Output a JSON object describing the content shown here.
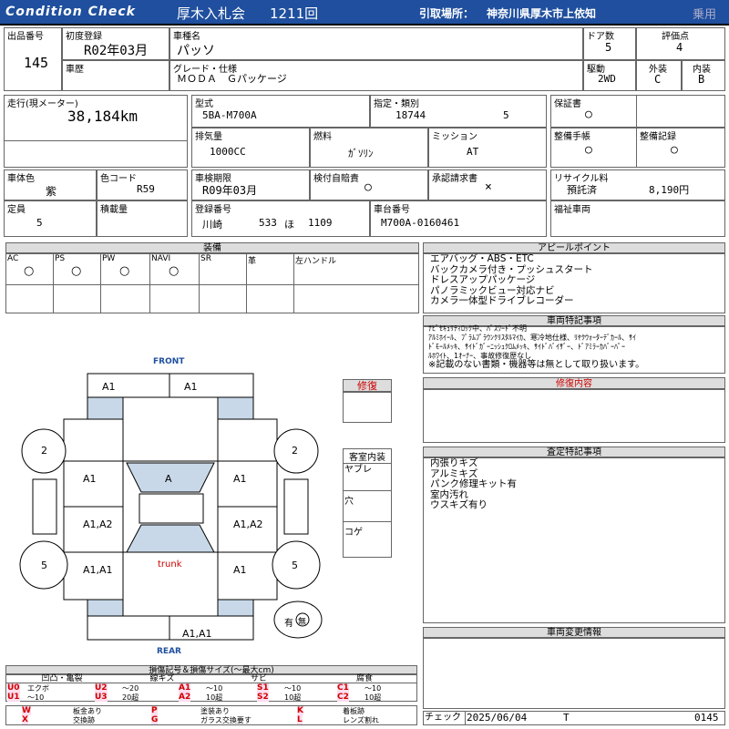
{
  "header": {
    "brand": "Condition Check",
    "auction": "厚木入札会",
    "session": "1211回",
    "pickup_label": "引取場所：",
    "pickup": "神奈川県厚木市上依知",
    "category": "乗用"
  },
  "row1": {
    "lot_label": "出品番号",
    "lot": "145",
    "first_reg_label": "初度登録",
    "first_reg": "R02年03月",
    "model_name_label": "車種名",
    "model_name": "パッソ",
    "doors_label": "ドア数",
    "doors": "5",
    "score_label": "評価点",
    "score": "4",
    "history_label": "車歴",
    "grade_label": "グレード・仕様",
    "grade": "ＭＯＤＡ　Ｇパッケージ",
    "drive_label": "駆動",
    "drive": "2WD",
    "ext_label": "外装",
    "ext": "C",
    "int_label": "内装",
    "int": "B"
  },
  "row2": {
    "mileage_label": "走行(現メーター)",
    "mileage": "38,184km",
    "type_label": "型式",
    "type": "5BA-M700A",
    "designation_label": "指定・類別",
    "designation": "18744",
    "class": "5",
    "warranty_label": "保証書",
    "warranty": "○",
    "displacement_label": "排気量",
    "displacement": "1000CC",
    "fuel_label": "燃料",
    "fuel": "ｶﾞｿﾘﾝ",
    "mission_label": "ミッション",
    "mission": "AT",
    "maint_book_label": "整備手帳",
    "maint_book": "○",
    "maint_record_label": "整備記録",
    "maint_record": "○"
  },
  "row3": {
    "color_label": "車体色",
    "color": "紫",
    "color_code_label": "色コード",
    "color_code": "R59",
    "inspection_label": "車検期限",
    "inspection": "R09年03月",
    "self_cert_label": "検付自賠責",
    "self_cert": "○",
    "approval_label": "承認請求書",
    "approval": "×",
    "recycle_label": "リサイクル料",
    "recycle_status": "預託済",
    "recycle_fee": "8,190円",
    "capacity_label": "定員",
    "capacity": "5",
    "load_label": "積載量",
    "reg_no_label": "登録番号",
    "reg_area": "川崎",
    "reg_class": "533",
    "reg_kana": "ほ",
    "reg_num": "1109",
    "vin_label": "車台番号",
    "vin": "M700A-0160461",
    "welfare_label": "福祉車両"
  },
  "equipment": {
    "title": "装備",
    "items": [
      {
        "label": "AC",
        "value": "○"
      },
      {
        "label": "PS",
        "value": "○"
      },
      {
        "label": "PW",
        "value": "○"
      },
      {
        "label": "NAVI",
        "value": "○"
      },
      {
        "label": "SR",
        "value": ""
      },
      {
        "label": "革",
        "value": ""
      },
      {
        "label": "左ハンドル",
        "value": ""
      }
    ]
  },
  "appeal": {
    "title": "アピールポイント",
    "lines": [
      "エアバッグ・ABS・ETC",
      "バックカメラ付き・プッシュスタート",
      "ドレスアップパッケージ",
      "パノラミックビュー対応ナビ",
      "カメラ一体型ドライブレコーダー"
    ]
  },
  "special": {
    "title": "車両特記事項",
    "lines": [
      "ﾅﾋﾞｾｷｭﾘﾃｨﾛｯｸ中、ﾊﾟｽﾜｰﾄﾞ不明",
      "ｱﾙﾐﾎｲｰﾙ、ﾌﾟﾗﾑﾌﾟﾗｳﾝｸﾘｽﾀﾙﾏｲｶ、寒冷地仕様、ﾘﾔｸｳｫｰﾀｰﾃﾞｶｰﾙ、ｻｲ",
      "ﾄﾞﾓｰﾙﾒｯｷ、ｻｲﾄﾞｶﾞｰﾆｯｼｭｸﾛﾑﾒｯｷ、ｻｲﾄﾞﾊﾞｲｻﾞｰ、ﾄﾞｱﾐﾗｰｶﾊﾞｰﾊﾟｰ",
      "ﾙﾎﾜｲﾄ、1ｵｰﾅｰ、事故修復歴なし",
      "※記載のない書類・機器等は無として取り扱います。"
    ]
  },
  "repair": {
    "label": "修復",
    "content_title": "修復内容"
  },
  "interior": {
    "title": "客室内装",
    "items": [
      "ヤブレ",
      "穴",
      "コゲ"
    ]
  },
  "inspection_notes": {
    "title": "査定特記事項",
    "lines": [
      "内張りキズ",
      "アルミキズ",
      "パンク修理キット有",
      "室内汚れ",
      "ウスキズ有り"
    ]
  },
  "change_info": {
    "title": "車両変更情報"
  },
  "diagram": {
    "front": "FRONT",
    "rear": "REAR",
    "trunk": "trunk",
    "marks": {
      "front_left": "A1",
      "front_right": "A1",
      "wheel_fl": "2",
      "wheel_fr": "2",
      "door_lf": "A1",
      "roof": "A",
      "door_rf": "A1",
      "door_lr": "A1,A2",
      "door_rr": "A1,A2",
      "qtr_l": "A1,A1",
      "qtr_r": "A1",
      "wheel_rl": "5",
      "wheel_rr": "5",
      "rear_bumper": "A1,A1"
    },
    "spare_label": "有",
    "spare_value": "無"
  },
  "legend": {
    "title": "損傷記号＆損傷サイズ(〜最大cm)",
    "groups": [
      "凹凸・亀裂",
      "線キズ",
      "サビ",
      "腐食"
    ],
    "rows": [
      [
        {
          "c": "U0",
          "t": "エクボ"
        },
        {
          "c": "U2",
          "t": "〜20"
        },
        {
          "c": "A1",
          "t": "〜10"
        },
        {
          "c": "S1",
          "t": "〜10"
        },
        {
          "c": "C1",
          "t": "〜10"
        }
      ],
      [
        {
          "c": "U1",
          "t": "〜10"
        },
        {
          "c": "U3",
          "t": "20超"
        },
        {
          "c": "A2",
          "t": "10超"
        },
        {
          "c": "S2",
          "t": "10超"
        },
        {
          "c": "C2",
          "t": "10超"
        }
      ]
    ],
    "rows2": [
      [
        {
          "c": "W",
          "t": "板金あり"
        },
        {
          "c": "P",
          "t": "塗装あり"
        },
        {
          "c": "K",
          "t": "着板跡"
        }
      ],
      [
        {
          "c": "X",
          "t": "交換跡"
        },
        {
          "c": "G",
          "t": "ガラス交換要す"
        },
        {
          "c": "L",
          "t": "レンズ割れ"
        }
      ]
    ]
  },
  "footer": {
    "check_label": "チェック",
    "date": "2025/06/04",
    "inspector": "T",
    "number": "0145"
  }
}
